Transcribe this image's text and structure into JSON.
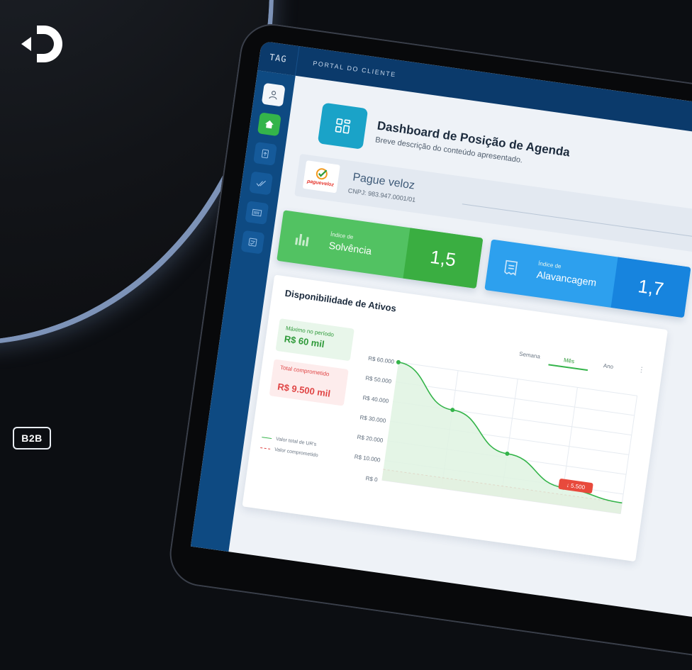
{
  "brand_badge": "B2B",
  "app": {
    "short_name": "TAG",
    "portal_label": "PORTAL DO CLIENTE"
  },
  "sidebar": {
    "items": [
      {
        "icon": "user-icon",
        "active": false
      },
      {
        "icon": "home-icon",
        "active": true
      },
      {
        "icon": "document-upload-icon",
        "active": false
      },
      {
        "icon": "check-list-icon",
        "active": false
      },
      {
        "icon": "barcode-icon",
        "active": false
      },
      {
        "icon": "checklist-form-icon",
        "active": false
      }
    ]
  },
  "page": {
    "title": "Dashboard de Posição de Agenda",
    "subtitle": "Breve descrição do conteúdo apresentado."
  },
  "company": {
    "name": "Pague veloz",
    "cnpj": "CNPJ: 983.947.0001/01",
    "logo_text": "pagueveloz"
  },
  "kpis": [
    {
      "small_label": "Índice de",
      "label": "Solvência",
      "value": "1,5",
      "color": "#52c262"
    },
    {
      "small_label": "Índice de",
      "label": "Alavancagem",
      "value": "1,7",
      "color": "#2da0ee"
    }
  ],
  "chart_card": {
    "title": "Disponibilidade de Ativos",
    "max_label": "Máximo no período",
    "max_value": "R$ 60 mil",
    "committed_label": "Total comprometido",
    "committed_value": "R$ 9.500 mil",
    "tabs": [
      "Semana",
      "Mês",
      "Ano"
    ],
    "active_tab": "Mês",
    "legend": [
      "Valor total de UR's",
      "Valor comprometido"
    ],
    "tooltip": "↓ 5.500"
  },
  "chart_data": {
    "type": "area",
    "yticks": [
      "R$ 60.000",
      "R$ 50.000",
      "R$ 40.000",
      "R$ 30.000",
      "R$ 20.000",
      "R$ 10.000",
      "R$ 0"
    ],
    "ylim": [
      0,
      60000
    ],
    "series": [
      {
        "name": "Valor total de UR's",
        "color": "#34b44a",
        "x": [
          0,
          1,
          2,
          3,
          4
        ],
        "values": [
          60000,
          40000,
          22000,
          9000,
          5500
        ]
      },
      {
        "name": "Valor comprometido",
        "color": "#e04545",
        "x": [
          0,
          1,
          2,
          3,
          4
        ],
        "values": [
          5500,
          5500,
          5500,
          5500,
          5500
        ]
      }
    ],
    "grid": true
  }
}
